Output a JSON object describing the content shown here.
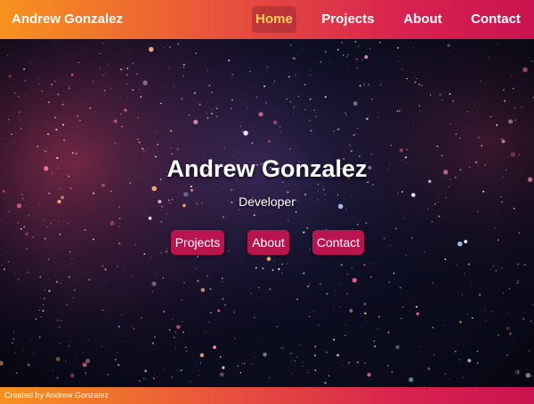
{
  "navbar": {
    "brand": "Andrew Gonzalez",
    "links": [
      {
        "label": "Home",
        "active": true
      },
      {
        "label": "Projects",
        "active": false
      },
      {
        "label": "About",
        "active": false
      },
      {
        "label": "Contact",
        "active": false
      }
    ]
  },
  "hero": {
    "name": "Andrew Gonzalez",
    "role": "Developer",
    "buttons": [
      {
        "label": "Projects"
      },
      {
        "label": "About"
      },
      {
        "label": "Contact"
      }
    ]
  },
  "footer": {
    "credit": "Created by Andrew Gonzalez"
  },
  "colors": {
    "gradient_start": "#f7921e",
    "gradient_end": "#c9134f",
    "active_nav_text": "#ffcf5a",
    "button_bg": "#b8154e",
    "space_bg": "#0b0c1e"
  }
}
